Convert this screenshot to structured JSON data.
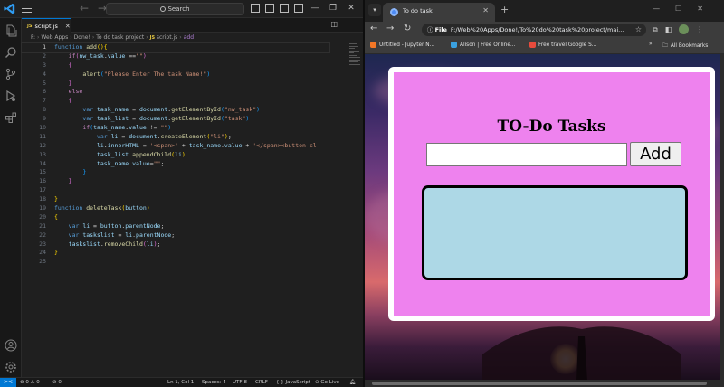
{
  "vscode": {
    "search_label": "Search",
    "tab": {
      "badge": "JS",
      "name": "script.js"
    },
    "breadcrumb": [
      "F:",
      "Web Apps",
      "Done!",
      "To do task project",
      "JS",
      "script.js",
      "add"
    ],
    "code_lines": [
      [
        [
          "kw",
          "function "
        ],
        [
          "fn",
          "add"
        ],
        [
          "br1",
          "(){"
        ]
      ],
      [
        [
          "pun",
          "    "
        ],
        [
          "kw2",
          "if"
        ],
        [
          "br2",
          "("
        ],
        [
          "vr",
          "nw_task"
        ],
        [
          "pun",
          "."
        ],
        [
          "vr",
          "value"
        ],
        [
          "pun",
          " =="
        ],
        [
          "str",
          "\"\""
        ],
        [
          "br2",
          ")"
        ]
      ],
      [
        [
          "pun",
          "    "
        ],
        [
          "br2",
          "{"
        ]
      ],
      [
        [
          "pun",
          "        "
        ],
        [
          "fn",
          "alert"
        ],
        [
          "br3",
          "("
        ],
        [
          "str",
          "\"Please Enter The task Name!\""
        ],
        [
          "br3",
          ")"
        ]
      ],
      [
        [
          "pun",
          "    "
        ],
        [
          "br2",
          "}"
        ]
      ],
      [
        [
          "pun",
          "    "
        ],
        [
          "kw2",
          "else"
        ]
      ],
      [
        [
          "pun",
          "    "
        ],
        [
          "br2",
          "{"
        ]
      ],
      [
        [
          "pun",
          "        "
        ],
        [
          "kw",
          "var "
        ],
        [
          "vr",
          "task_name"
        ],
        [
          "pun",
          " = "
        ],
        [
          "vr",
          "document"
        ],
        [
          "pun",
          "."
        ],
        [
          "fn",
          "getElementById"
        ],
        [
          "br3",
          "("
        ],
        [
          "str",
          "\"nw_task\""
        ],
        [
          "br3",
          ")"
        ]
      ],
      [
        [
          "pun",
          "        "
        ],
        [
          "kw",
          "var "
        ],
        [
          "vr",
          "task_list"
        ],
        [
          "pun",
          " = "
        ],
        [
          "vr",
          "document"
        ],
        [
          "pun",
          "."
        ],
        [
          "fn",
          "getElementById"
        ],
        [
          "br3",
          "("
        ],
        [
          "str",
          "\"task\""
        ],
        [
          "br3",
          ")"
        ]
      ],
      [
        [
          "pun",
          "        "
        ],
        [
          "kw2",
          "if"
        ],
        [
          "br3",
          "("
        ],
        [
          "vr",
          "task_name"
        ],
        [
          "pun",
          "."
        ],
        [
          "vr",
          "value"
        ],
        [
          "pun",
          " != "
        ],
        [
          "str",
          "\"\""
        ],
        [
          "br3",
          ")"
        ]
      ],
      [
        [
          "pun",
          "            "
        ],
        [
          "kw",
          "var "
        ],
        [
          "vr",
          "li"
        ],
        [
          "pun",
          " = "
        ],
        [
          "vr",
          "document"
        ],
        [
          "pun",
          "."
        ],
        [
          "fn",
          "createElement"
        ],
        [
          "br1",
          "("
        ],
        [
          "str",
          "\"li\""
        ],
        [
          "br1",
          ")"
        ],
        [
          "pun",
          ";"
        ]
      ],
      [
        [
          "pun",
          "            "
        ],
        [
          "vr",
          "li"
        ],
        [
          "pun",
          "."
        ],
        [
          "vr",
          "innerHTML"
        ],
        [
          "pun",
          " = "
        ],
        [
          "str",
          "'<span>'"
        ],
        [
          "pun",
          " + "
        ],
        [
          "vr",
          "task_name"
        ],
        [
          "pun",
          "."
        ],
        [
          "vr",
          "value"
        ],
        [
          "pun",
          " + "
        ],
        [
          "str",
          "'</span><button cl"
        ]
      ],
      [
        [
          "pun",
          "            "
        ],
        [
          "vr",
          "task_list"
        ],
        [
          "pun",
          "."
        ],
        [
          "fn",
          "appendChild"
        ],
        [
          "br1",
          "("
        ],
        [
          "vr",
          "li"
        ],
        [
          "br1",
          ")"
        ]
      ],
      [
        [
          "pun",
          "            "
        ],
        [
          "vr",
          "task_name"
        ],
        [
          "pun",
          "."
        ],
        [
          "vr",
          "value"
        ],
        [
          "pun",
          "="
        ],
        [
          "str",
          "\"\""
        ],
        [
          "pun",
          ";"
        ]
      ],
      [
        [
          "pun",
          "        "
        ],
        [
          "br3",
          "}"
        ]
      ],
      [
        [
          "pun",
          "    "
        ],
        [
          "br2",
          "}"
        ]
      ],
      [
        [
          "pun",
          ""
        ]
      ],
      [
        [
          "br1",
          "}"
        ]
      ],
      [
        [
          "kw",
          "function "
        ],
        [
          "fn",
          "deleteTask"
        ],
        [
          "br1",
          "("
        ],
        [
          "vr",
          "button"
        ],
        [
          "br1",
          ")"
        ]
      ],
      [
        [
          "br1",
          "{"
        ]
      ],
      [
        [
          "pun",
          "    "
        ],
        [
          "kw",
          "var "
        ],
        [
          "vr",
          "li"
        ],
        [
          "pun",
          " = "
        ],
        [
          "vr",
          "button"
        ],
        [
          "pun",
          "."
        ],
        [
          "vr",
          "parentNode"
        ],
        [
          "pun",
          ";"
        ]
      ],
      [
        [
          "pun",
          "    "
        ],
        [
          "kw",
          "var "
        ],
        [
          "vr",
          "taskslist"
        ],
        [
          "pun",
          " = "
        ],
        [
          "vr",
          "li"
        ],
        [
          "pun",
          "."
        ],
        [
          "vr",
          "parentNode"
        ],
        [
          "pun",
          ";"
        ]
      ],
      [
        [
          "pun",
          "    "
        ],
        [
          "vr",
          "taskslist"
        ],
        [
          "pun",
          "."
        ],
        [
          "fn",
          "removeChild"
        ],
        [
          "br2",
          "("
        ],
        [
          "vr",
          "li"
        ],
        [
          "br2",
          ")"
        ],
        [
          "pun",
          ";"
        ]
      ],
      [
        [
          "br1",
          "}"
        ]
      ],
      [
        [
          "pun",
          ""
        ]
      ]
    ],
    "status": {
      "remote": "><",
      "errors": "⊗ 0  ⚠ 0",
      "ports": "⊘ 0",
      "position": "Ln 1, Col 1",
      "spaces": "Spaces: 4",
      "encoding": "UTF-8",
      "eol": "CRLF",
      "language": "{ }  JavaScript",
      "golive": "⊙ Go Live"
    }
  },
  "chrome": {
    "tab_title": "To do task",
    "address": "F:/Web%20Apps/Done!/To%20do%20task%20project/mai...",
    "address_chip": "File",
    "bookmarks": [
      {
        "label": "Untitled - Jupyter N...",
        "color": "#f37726"
      },
      {
        "label": "Alison | Free Online...",
        "color": "#3aa1e0"
      },
      {
        "label": "Free travel Google S...",
        "color": "#e84b3c"
      }
    ],
    "all_bookmarks": "All Bookmarks",
    "page": {
      "title": "TO-Do Tasks",
      "input_value": "",
      "add_label": "Add"
    }
  }
}
